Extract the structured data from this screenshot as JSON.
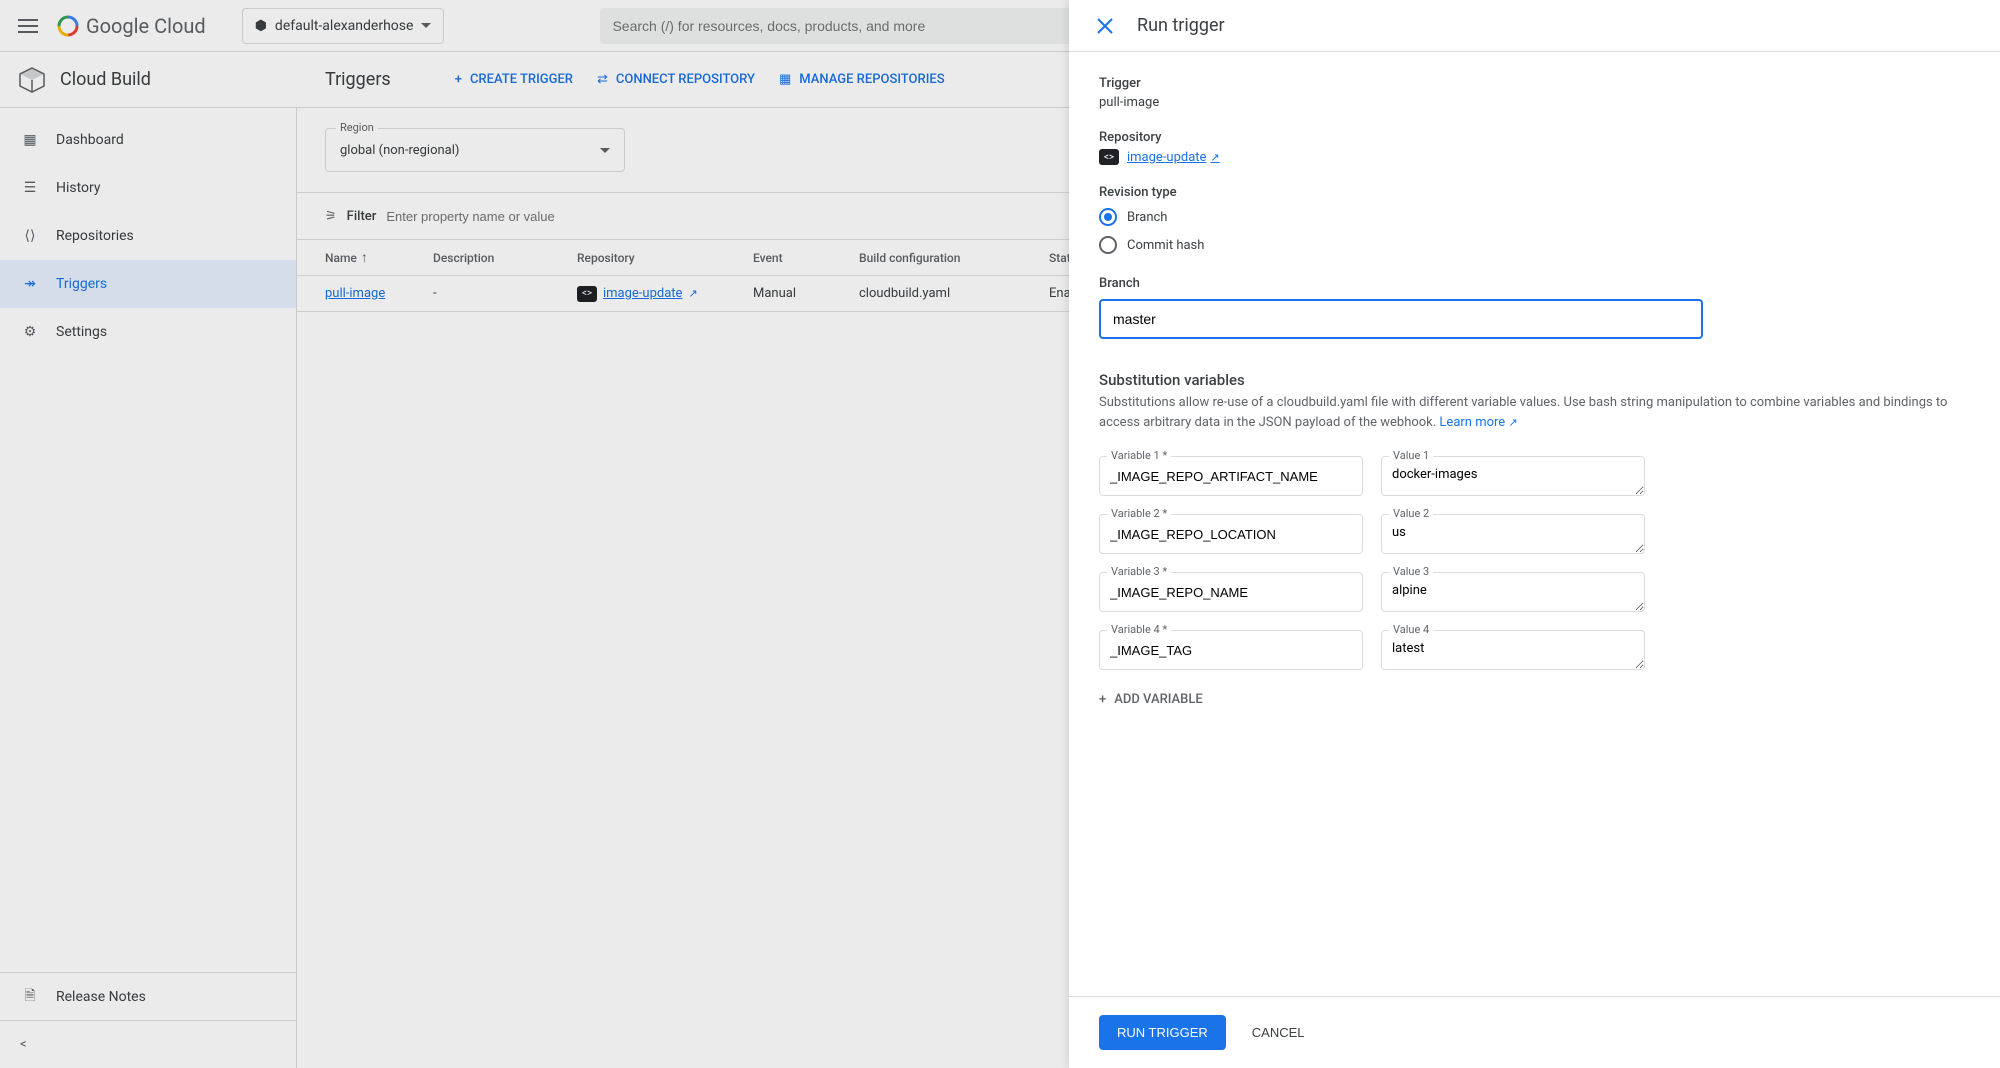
{
  "header": {
    "logo_text": "Google Cloud",
    "project": "default-alexanderhose",
    "search_placeholder": "Search (/) for resources, docs, products, and more"
  },
  "service": {
    "name": "Cloud Build",
    "page_title": "Triggers",
    "actions": {
      "create": "CREATE TRIGGER",
      "connect": "CONNECT REPOSITORY",
      "manage": "MANAGE REPOSITORIES"
    }
  },
  "sidebar": {
    "items": [
      {
        "label": "Dashboard"
      },
      {
        "label": "History"
      },
      {
        "label": "Repositories"
      },
      {
        "label": "Triggers"
      },
      {
        "label": "Settings"
      }
    ],
    "release_notes": "Release Notes"
  },
  "region": {
    "label": "Region",
    "value": "global (non-regional)"
  },
  "filter": {
    "label": "Filter",
    "placeholder": "Enter property name or value"
  },
  "table": {
    "headers": {
      "name": "Name",
      "description": "Description",
      "repository": "Repository",
      "event": "Event",
      "build": "Build configuration",
      "status": "Status"
    },
    "rows": [
      {
        "name": "pull-image",
        "description": "-",
        "repository": "image-update",
        "event": "Manual",
        "build": "cloudbuild.yaml",
        "status": "Enabled"
      }
    ]
  },
  "panel": {
    "title": "Run trigger",
    "trigger_label": "Trigger",
    "trigger_value": "pull-image",
    "repository_label": "Repository",
    "repository_value": "image-update",
    "revision_label": "Revision type",
    "revision_branch": "Branch",
    "revision_commit": "Commit hash",
    "branch_label": "Branch",
    "branch_value": "master",
    "subst_title": "Substitution variables",
    "subst_desc": "Substitutions allow re-use of a cloudbuild.yaml file with different variable values. Use bash string manipulation to combine variables and bindings to access arbitrary data in the JSON payload of the webhook. ",
    "learn_more": "Learn more",
    "vars": [
      {
        "label": "Variable 1 *",
        "name": "_IMAGE_REPO_ARTIFACT_NAME",
        "vlabel": "Value 1",
        "value": "docker-images"
      },
      {
        "label": "Variable 2 *",
        "name": "_IMAGE_REPO_LOCATION",
        "vlabel": "Value 2",
        "value": "us"
      },
      {
        "label": "Variable 3 *",
        "name": "_IMAGE_REPO_NAME",
        "vlabel": "Value 3",
        "value": "alpine"
      },
      {
        "label": "Variable 4 *",
        "name": "_IMAGE_TAG",
        "vlabel": "Value 4",
        "value": "latest"
      }
    ],
    "add_variable": "ADD VARIABLE",
    "run_button": "RUN TRIGGER",
    "cancel_button": "CANCEL"
  }
}
